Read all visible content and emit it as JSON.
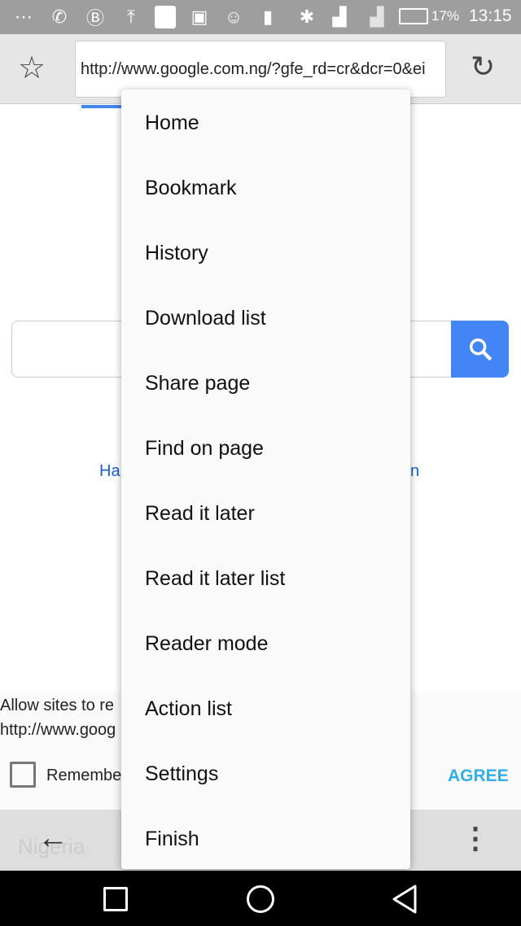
{
  "status_bar": {
    "battery": "17%",
    "time": "13:15",
    "icons": [
      "messages-icon",
      "whatsapp-icon",
      "b-app-icon",
      "upload-icon",
      "blank-notification-icon",
      "image-icon",
      "chat-icon",
      "sd-card-alert-icon",
      "bluetooth-icon",
      "signal-h-plus-icon",
      "signal-icon",
      "battery-icon"
    ]
  },
  "toolbar": {
    "url": "http://www.google.com.ng/?gfe_rd=cr&dcr=0&ei"
  },
  "page": {
    "link_left": "Ha",
    "link_right": "n",
    "footer_text": "Nigeria"
  },
  "dialog": {
    "line1": "Allow sites to re",
    "line2": "http://www.goog",
    "remember": "Remembe",
    "agree": "AGREE"
  },
  "menu": {
    "items": [
      "Home",
      "Bookmark",
      "History",
      "Download list",
      "Share page",
      "Find on page",
      "Read it later",
      "Read it later list",
      "Reader mode",
      "Action list",
      "Settings",
      "Finish"
    ]
  },
  "colors": {
    "accent": "#4285f4",
    "agree": "#33aee6"
  }
}
